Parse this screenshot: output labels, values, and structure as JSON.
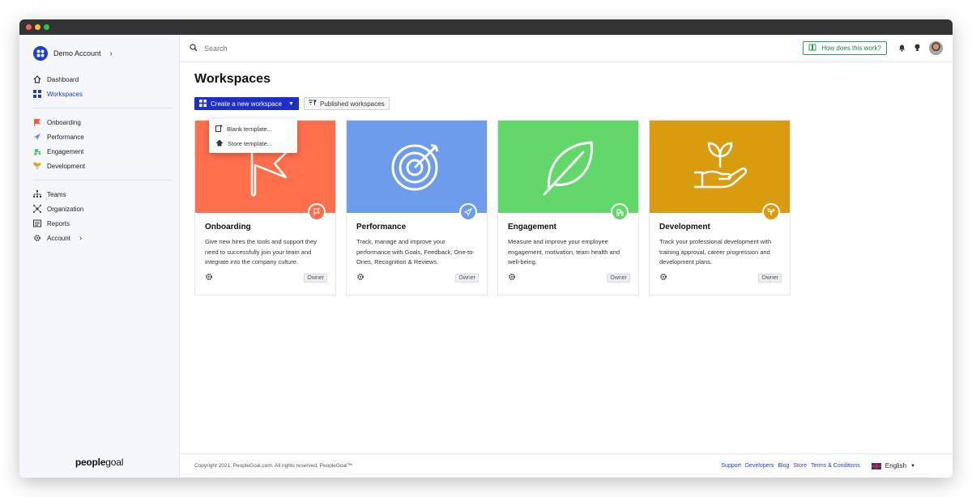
{
  "window": {
    "dots": [
      "#ff5f57",
      "#febc2e",
      "#28c840"
    ]
  },
  "sidebar": {
    "account": {
      "name": "Demo Account"
    },
    "primary": [
      {
        "label": "Dashboard",
        "icon": "home-icon"
      },
      {
        "label": "Workspaces",
        "icon": "grid-icon"
      }
    ],
    "workspaces": [
      {
        "label": "Onboarding",
        "icon": "flag-icon",
        "color": "#ff6b4a"
      },
      {
        "label": "Performance",
        "icon": "paper-plane-icon",
        "color": "#5b8def"
      },
      {
        "label": "Engagement",
        "icon": "tractor-icon",
        "color": "#4cc85c"
      },
      {
        "label": "Development",
        "icon": "sprout-icon",
        "color": "#e0a11b"
      }
    ],
    "secondary": [
      {
        "label": "Teams",
        "icon": "org-chart-icon"
      },
      {
        "label": "Organization",
        "icon": "network-icon"
      },
      {
        "label": "Reports",
        "icon": "report-icon"
      },
      {
        "label": "Account",
        "icon": "gear-icon"
      }
    ],
    "brand": {
      "bold": "people",
      "light": "goal"
    }
  },
  "topbar": {
    "search_placeholder": "Search",
    "how_label": "How does this work?"
  },
  "main": {
    "title": "Workspaces",
    "create_label": "Create a new workspace",
    "published_label": "Published workspaces",
    "dropdown": [
      {
        "label": "Blank template...",
        "icon": "new-document-icon"
      },
      {
        "label": "Store template...",
        "icon": "cloud-store-icon"
      }
    ],
    "cards": [
      {
        "title": "Onboarding",
        "desc": "Give new hires the tools and support they need to successfully join your team and integrate into the company culture.",
        "color": "#ff6f4b",
        "tag": "Owner",
        "icon": "flag-icon"
      },
      {
        "title": "Performance",
        "desc": "Track, manage and improve your performance with Goals, Feedback, One-to-Ones, Recognition & Reviews.",
        "color": "#6d9ced",
        "tag": "Owner",
        "icon": "target-icon"
      },
      {
        "title": "Engagement",
        "desc": "Measure and improve your employee engagement, motivation, team health and well-being.",
        "color": "#62d86b",
        "tag": "Owner",
        "icon": "leaf-icon"
      },
      {
        "title": "Development",
        "desc": "Track your professional development with training approval, career progression and development plans.",
        "color": "#d99c0e",
        "tag": "Owner",
        "icon": "hand-plant-icon"
      }
    ]
  },
  "footer": {
    "copyright": "Copyright 2021, PeopleGoal.com. All rights reserved, PeopleGoal™",
    "links": [
      "Support",
      "Developers",
      "Blog",
      "Store",
      "Terms & Conditions"
    ],
    "language": "English"
  }
}
